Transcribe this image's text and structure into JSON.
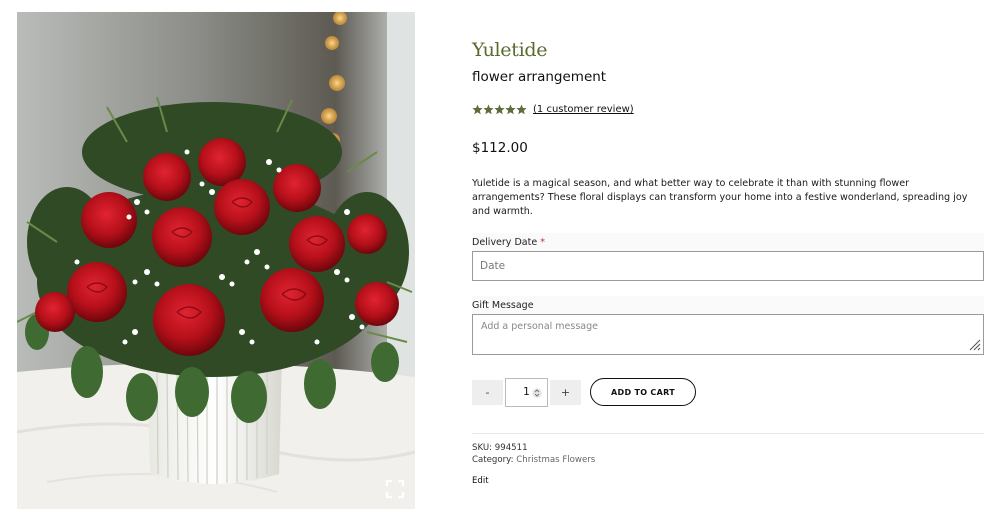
{
  "product": {
    "title": "Yuletide",
    "subtitle": "flower arrangement",
    "rating": 5,
    "review_link": "(1 customer review)",
    "price": "$112.00",
    "description": "Yuletide is a magical season, and what better way to celebrate it than with stunning flower arrangements? These floral displays can transform your home into a festive wonderland, spreading joy and warmth."
  },
  "form": {
    "delivery_label": "Delivery Date",
    "required_mark": "*",
    "date_placeholder": "Date",
    "gift_label": "Gift Message",
    "gift_placeholder": "Add a personal message"
  },
  "cart": {
    "minus": "-",
    "quantity": "1",
    "plus": "+",
    "add_label": "ADD TO CART"
  },
  "meta": {
    "sku_label": "SKU:",
    "sku": "994511",
    "category_label": "Category:",
    "category": "Christmas Flowers",
    "edit": "Edit"
  },
  "icons": {
    "zoom": "fullscreen-icon",
    "star": "star-icon"
  },
  "colors": {
    "title": "#5a6b2e",
    "star": "#5e6b3a",
    "rose": "#b5101a"
  }
}
